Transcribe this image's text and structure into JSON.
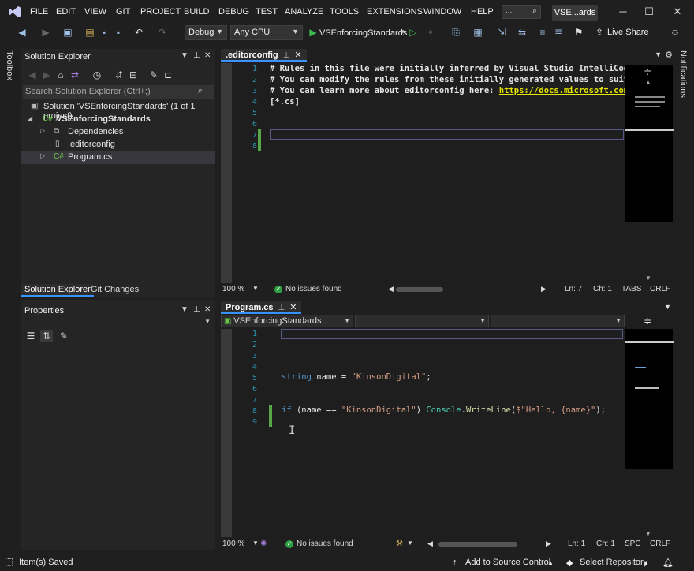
{
  "menu": {
    "items": [
      "FILE",
      "EDIT",
      "VIEW",
      "GIT",
      "PROJECT",
      "BUILD",
      "DEBUG",
      "TEST",
      "ANALYZE",
      "TOOLS",
      "EXTENSIONS",
      "WINDOW",
      "HELP"
    ],
    "search_placeholder": "...",
    "solution_badge": "VSE...ards"
  },
  "toolbar": {
    "config": "Debug",
    "platform": "Any CPU",
    "run_target": "VSEnforcingStandards",
    "live_share": "Live Share"
  },
  "rails": {
    "left": "Toolbox",
    "right": "Notifications"
  },
  "solution_explorer": {
    "title": "Solution Explorer",
    "search_placeholder": "Search Solution Explorer (Ctrl+;)",
    "tree": [
      {
        "label": "Solution 'VSEnforcingStandards' (1 of 1 project)",
        "icon": "solution-icon"
      },
      {
        "label": "VSEnforcingStandards",
        "icon": "csharp-project-icon"
      },
      {
        "label": "Dependencies",
        "icon": "dependencies-icon"
      },
      {
        "label": ".editorconfig",
        "icon": "file-icon"
      },
      {
        "label": "Program.cs",
        "icon": "csharp-file-icon"
      }
    ],
    "tabs": [
      "Solution Explorer",
      "Git Changes"
    ]
  },
  "properties": {
    "title": "Properties"
  },
  "editor_top": {
    "tab": ".editorconfig",
    "lines": [
      "# Rules in this file were initially inferred by Visual Studio IntelliCod",
      "# You can modify the rules from these initially generated values to suit",
      "# You can learn more about editorconfig here: ",
      "[*.cs]",
      "",
      "",
      "",
      ""
    ],
    "link_text": "https://docs.microsoft.com",
    "zoom": "100 %",
    "issues": "No issues found",
    "ln": "Ln: 7",
    "ch": "Ch: 1",
    "tabs_mode": "TABS",
    "eol": "CRLF"
  },
  "editor_bottom": {
    "tab": "Program.cs",
    "nav_project": "VSEnforcingStandards",
    "line_numbers": [
      "1",
      "2",
      "3",
      "4",
      "5",
      "6",
      "7",
      "8",
      "9"
    ],
    "line5": {
      "kw": "string",
      "rest": " name = ",
      "str": "\"KinsonDigital\"",
      "end": ";"
    },
    "line8": {
      "kw": "if",
      "p1": " (name == ",
      "str": "\"KinsonDigital\"",
      "p2": ") ",
      "ty": "Console",
      "dot": ".",
      "fn": "WriteLine",
      "p3": "(",
      "str2": "$\"Hello, {name}\"",
      "end": ");"
    },
    "zoom": "100 %",
    "issues": "No issues found",
    "ln": "Ln: 1",
    "ch": "Ch: 1",
    "tabs_mode": "SPC",
    "eol": "CRLF"
  },
  "top_line_numbers": [
    "1",
    "2",
    "3",
    "4",
    "5",
    "6",
    "7",
    "8"
  ],
  "status": {
    "saved": "Item(s) Saved",
    "add_source": "Add to Source Control",
    "select_repo": "Select Repository"
  }
}
